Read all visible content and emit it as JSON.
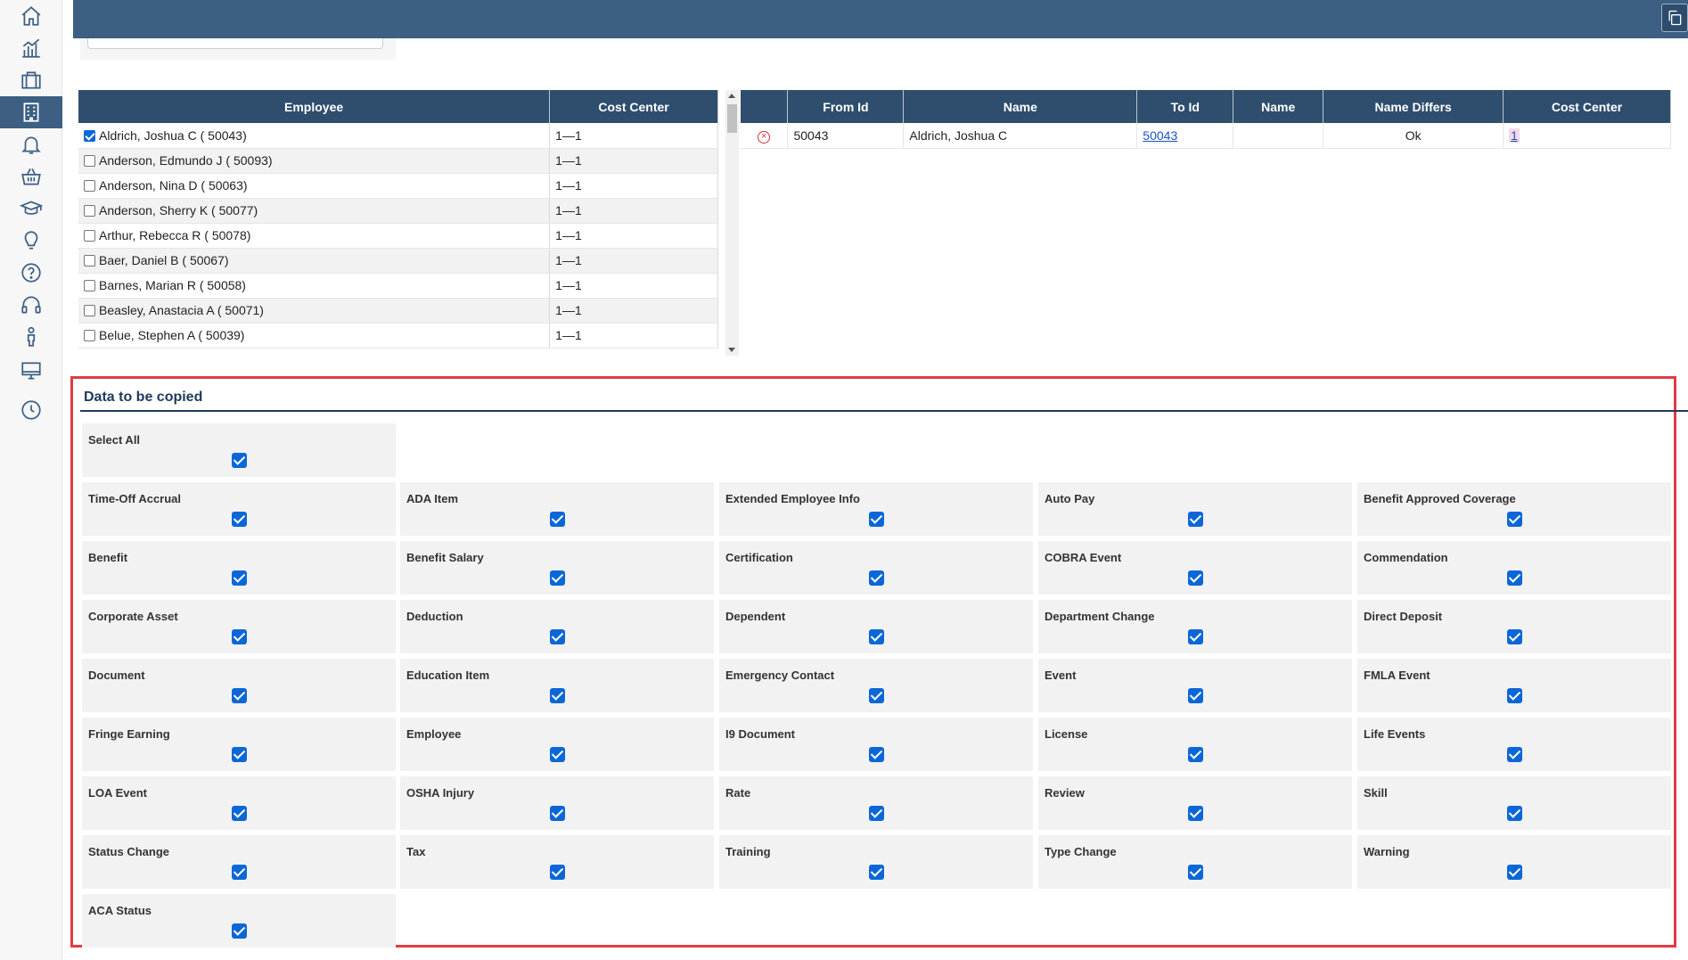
{
  "sidebar": {
    "items": [
      {
        "icon": "home-icon"
      },
      {
        "icon": "analytics-icon"
      },
      {
        "icon": "briefcase-icon"
      },
      {
        "icon": "building-icon",
        "active": true
      },
      {
        "icon": "bell-icon"
      },
      {
        "icon": "basket-icon"
      },
      {
        "icon": "graduation-cap-icon"
      },
      {
        "icon": "lightbulb-icon"
      },
      {
        "icon": "help-icon"
      },
      {
        "icon": "headset-icon"
      },
      {
        "icon": "person-icon"
      },
      {
        "icon": "monitor-icon"
      },
      {
        "icon": "clock-icon"
      }
    ]
  },
  "topbar": {
    "color": "#3c5f83",
    "copy_icon": "copy-icon"
  },
  "employee_table": {
    "headers": {
      "employee": "Employee",
      "cost_center": "Cost Center"
    },
    "rows": [
      {
        "name": "Aldrich, Joshua C ( 50043)",
        "cost_center": "1—1",
        "checked": true
      },
      {
        "name": "Anderson, Edmundo J ( 50093)",
        "cost_center": "1—1",
        "checked": false
      },
      {
        "name": "Anderson, Nina D ( 50063)",
        "cost_center": "1—1",
        "checked": false
      },
      {
        "name": "Anderson, Sherry K ( 50077)",
        "cost_center": "1—1",
        "checked": false
      },
      {
        "name": "Arthur, Rebecca R ( 50078)",
        "cost_center": "1—1",
        "checked": false
      },
      {
        "name": "Baer, Daniel B ( 50067)",
        "cost_center": "1—1",
        "checked": false
      },
      {
        "name": "Barnes, Marian R ( 50058)",
        "cost_center": "1—1",
        "checked": false
      },
      {
        "name": "Beasley, Anastacia A ( 50071)",
        "cost_center": "1—1",
        "checked": false
      },
      {
        "name": "Belue, Stephen A ( 50039)",
        "cost_center": "1—1",
        "checked": false
      }
    ]
  },
  "mapping_table": {
    "headers": {
      "from_id": "From Id",
      "name": "Name",
      "to_id": "To Id",
      "to_name": "Name",
      "name_differs": "Name Differs",
      "cost_center": "Cost Center"
    },
    "rows": [
      {
        "remove_icon": "remove-circle-icon",
        "from_id": "50043",
        "name": "Aldrich, Joshua C",
        "to_id": "50043",
        "to_name": "",
        "name_differs": "Ok",
        "cost_center": "1"
      }
    ]
  },
  "copy_section": {
    "title": "Data to be copied",
    "select_all": {
      "label": "Select All",
      "checked": true
    },
    "options": [
      {
        "label": "Time-Off Accrual",
        "checked": true
      },
      {
        "label": "ADA Item",
        "checked": true
      },
      {
        "label": "Extended Employee Info",
        "checked": true
      },
      {
        "label": "Auto Pay",
        "checked": true
      },
      {
        "label": "Benefit Approved Coverage",
        "checked": true
      },
      {
        "label": "Benefit",
        "checked": true
      },
      {
        "label": "Benefit Salary",
        "checked": true
      },
      {
        "label": "Certification",
        "checked": true
      },
      {
        "label": "COBRA Event",
        "checked": true
      },
      {
        "label": "Commendation",
        "checked": true
      },
      {
        "label": "Corporate Asset",
        "checked": true
      },
      {
        "label": "Deduction",
        "checked": true
      },
      {
        "label": "Dependent",
        "checked": true
      },
      {
        "label": "Department Change",
        "checked": true
      },
      {
        "label": "Direct Deposit",
        "checked": true
      },
      {
        "label": "Document",
        "checked": true
      },
      {
        "label": "Education Item",
        "checked": true
      },
      {
        "label": "Emergency Contact",
        "checked": true
      },
      {
        "label": "Event",
        "checked": true
      },
      {
        "label": "FMLA Event",
        "checked": true
      },
      {
        "label": "Fringe Earning",
        "checked": true
      },
      {
        "label": "Employee",
        "checked": true
      },
      {
        "label": "I9 Document",
        "checked": true
      },
      {
        "label": "License",
        "checked": true
      },
      {
        "label": "Life Events",
        "checked": true
      },
      {
        "label": "LOA Event",
        "checked": true
      },
      {
        "label": "OSHA Injury",
        "checked": true
      },
      {
        "label": "Rate",
        "checked": true
      },
      {
        "label": "Review",
        "checked": true
      },
      {
        "label": "Skill",
        "checked": true
      },
      {
        "label": "Status Change",
        "checked": true
      },
      {
        "label": "Tax",
        "checked": true
      },
      {
        "label": "Training",
        "checked": true
      },
      {
        "label": "Type Change",
        "checked": true
      },
      {
        "label": "Warning",
        "checked": true
      },
      {
        "label": "ACA Status",
        "checked": true
      }
    ]
  },
  "colors": {
    "header": "#2f4e6d",
    "accent": "#0b67d8",
    "highlight_border": "#e23b44"
  }
}
